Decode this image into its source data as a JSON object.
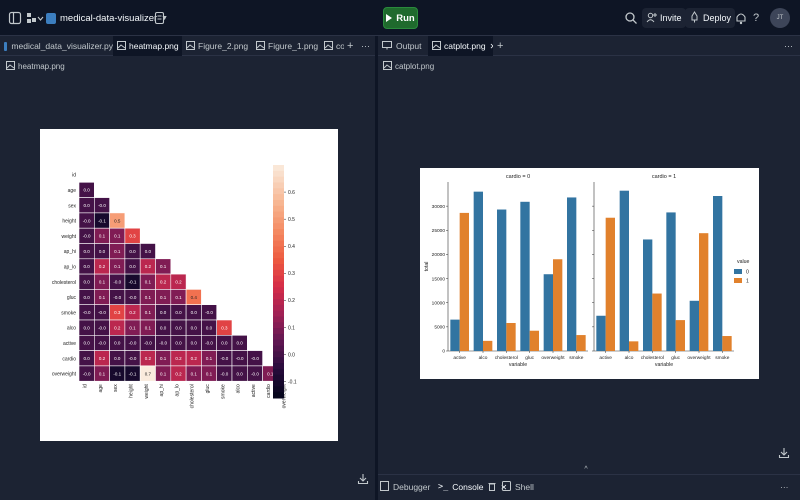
{
  "top": {
    "repl_name": "medical-data-visualizer",
    "run_label": "Run",
    "invite_label": "Invite",
    "deploy_label": "Deploy",
    "help_glyph": "?",
    "avatar_initials": "JT"
  },
  "left_pane": {
    "tabs": [
      {
        "label": "medical_data_visualizer.py",
        "icon": "python-file-icon"
      },
      {
        "label": "heatmap.png",
        "icon": "image-icon",
        "active": true
      },
      {
        "label": "Figure_2.png",
        "icon": "image-icon"
      },
      {
        "label": "Figure_1.png",
        "icon": "image-icon"
      },
      {
        "label": "co",
        "icon": "image-icon"
      }
    ],
    "breadcrumb": "heatmap.png",
    "add_tab_glyph": "+",
    "more_glyph": "···"
  },
  "right_pane": {
    "tabs": [
      {
        "label": "Output",
        "icon": "monitor-icon"
      },
      {
        "label": "catplot.png",
        "icon": "image-icon",
        "active": true
      }
    ],
    "breadcrumb": "catplot.png",
    "add_tab_glyph": "+",
    "more_glyph": "···"
  },
  "bottom_tabs": [
    {
      "label": "Debugger",
      "icon": "debugger-icon"
    },
    {
      "label": "Console",
      "icon": "console-icon",
      "active": true
    },
    {
      "label": "Shell",
      "icon": "shell-icon"
    }
  ],
  "bottom_more": "···",
  "heatmap": {
    "labels": [
      "id",
      "age",
      "sex",
      "height",
      "weight",
      "ap_hi",
      "ap_lo",
      "cholesterol",
      "gluc",
      "smoke",
      "alco",
      "active",
      "cardio",
      "overweight"
    ],
    "values": [
      [],
      [
        "0.0"
      ],
      [
        "0.0",
        "-0.0"
      ],
      [
        "-0.0",
        "-0.1",
        "0.5"
      ],
      [
        "-0.0",
        "0.1",
        "0.1",
        "0.3"
      ],
      [
        "0.0",
        "0.0",
        "0.1",
        "0.0",
        "0.0"
      ],
      [
        "0.0",
        "0.2",
        "0.1",
        "0.0",
        "0.2",
        "0.1"
      ],
      [
        "0.0",
        "0.1",
        "-0.0",
        "-0.1",
        "0.1",
        "0.2",
        "0.2"
      ],
      [
        "0.0",
        "0.1",
        "-0.0",
        "-0.0",
        "0.1",
        "0.1",
        "0.1",
        "0.4"
      ],
      [
        "-0.0",
        "-0.0",
        "0.3",
        "0.2",
        "0.1",
        "0.0",
        "0.0",
        "0.0",
        "-0.0"
      ],
      [
        "0.0",
        "-0.0",
        "0.2",
        "0.1",
        "0.1",
        "0.0",
        "0.0",
        "0.0",
        "0.0",
        "0.3"
      ],
      [
        "0.0",
        "-0.0",
        "0.0",
        "-0.0",
        "-0.0",
        "-0.0",
        "0.0",
        "0.0",
        "-0.0",
        "0.0",
        "0.0"
      ],
      [
        "0.0",
        "0.2",
        "0.0",
        "-0.0",
        "0.2",
        "0.1",
        "0.2",
        "0.2",
        "0.1",
        "-0.0",
        "-0.0",
        "-0.0"
      ],
      [
        "-0.0",
        "0.1",
        "-0.1",
        "-0.1",
        "0.7",
        "0.1",
        "0.2",
        "0.1",
        "0.1",
        "-0.0",
        "0.0",
        "-0.0",
        "0.1"
      ]
    ],
    "colorbar_ticks": [
      "0.6",
      "0.5",
      "0.4",
      "0.3",
      "0.2",
      "0.1",
      "0.0",
      "-0.1"
    ],
    "colorbar_range": [
      -0.16,
      0.7
    ]
  },
  "chart_data": {
    "type": "bar",
    "panels": [
      {
        "title": "cardio = 0",
        "categories": [
          "active",
          "alco",
          "cholesterol",
          "gluc",
          "overweight",
          "smoke"
        ],
        "series": [
          {
            "name": "0",
            "values": [
              6500,
              33000,
              29300,
              30900,
              15900,
              31800
            ]
          },
          {
            "name": "1",
            "values": [
              28600,
              2100,
              5800,
              4200,
              19000,
              3300
            ]
          }
        ]
      },
      {
        "title": "cardio = 1",
        "categories": [
          "active",
          "alco",
          "cholesterol",
          "gluc",
          "overweight",
          "smoke"
        ],
        "series": [
          {
            "name": "0",
            "values": [
              7300,
              33200,
              23100,
              28700,
              10400,
              32100
            ]
          },
          {
            "name": "1",
            "values": [
              27600,
              2000,
              11900,
              6400,
              24400,
              3100
            ]
          }
        ]
      }
    ],
    "xlabel": "variable",
    "ylabel": "total",
    "ylim": [
      0,
      35000
    ],
    "yticks": [
      "0",
      "5000",
      "10000",
      "15000",
      "20000",
      "25000",
      "30000"
    ],
    "legend_title": "value",
    "legend_labels": [
      "0",
      "1"
    ],
    "colors": {
      "0": "#3274a1",
      "1": "#e1812c"
    }
  },
  "colors": {
    "app_bg": "#0e1525",
    "pane_bg": "#1c2333",
    "run_green": "#1f6a2d",
    "heatmap_low": "#03051a",
    "heatmap_high": "#faebdd"
  }
}
